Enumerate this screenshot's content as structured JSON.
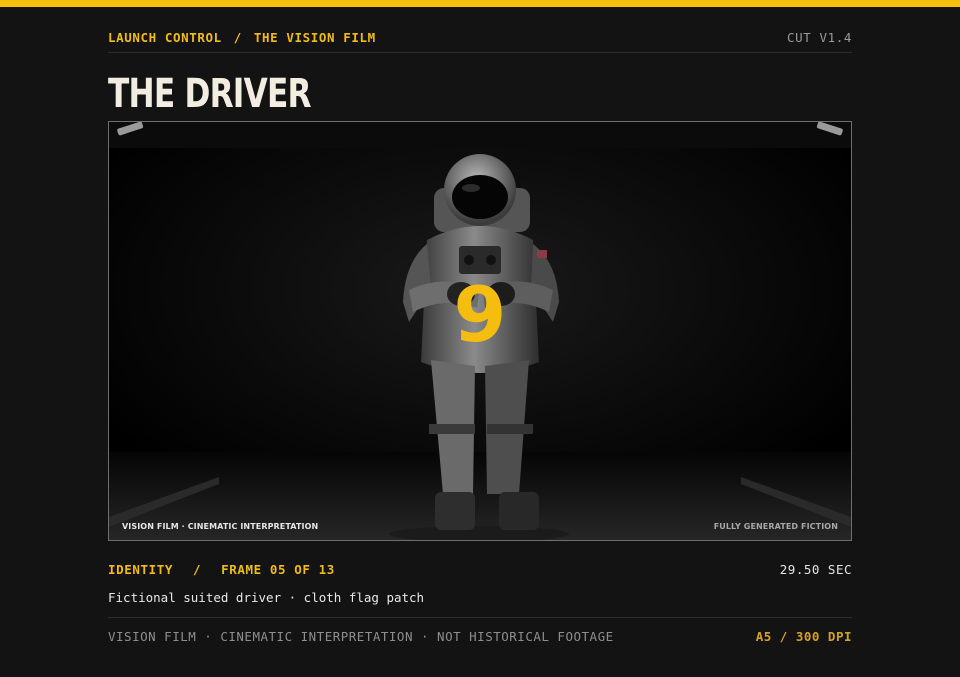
{
  "header": {
    "breadcrumb": [
      "LAUNCH CONTROL",
      "THE VISION FILM"
    ],
    "separator": "/",
    "version": "CUT V1.4"
  },
  "page_title": "THE DRIVER",
  "frame": {
    "image_subject": "suited-driver-figure",
    "number_badge": "9",
    "caption_left": "VISION FILM · CINEMATIC INTERPRETATION",
    "caption_right": "FULLY GENERATED FICTION"
  },
  "meta": {
    "section": "IDENTITY",
    "separator": "/",
    "frame_index": "FRAME 05 OF 13",
    "duration": "29.50 SEC",
    "description": "Fictional suited driver · cloth flag patch"
  },
  "footer": {
    "note": "VISION FILM · CINEMATIC INTERPRETATION · NOT HISTORICAL FOOTAGE",
    "format": "A5 / 300 DPI"
  },
  "colors": {
    "accent": "#f5bd0e",
    "background": "#131313",
    "title": "#f2ede0"
  }
}
